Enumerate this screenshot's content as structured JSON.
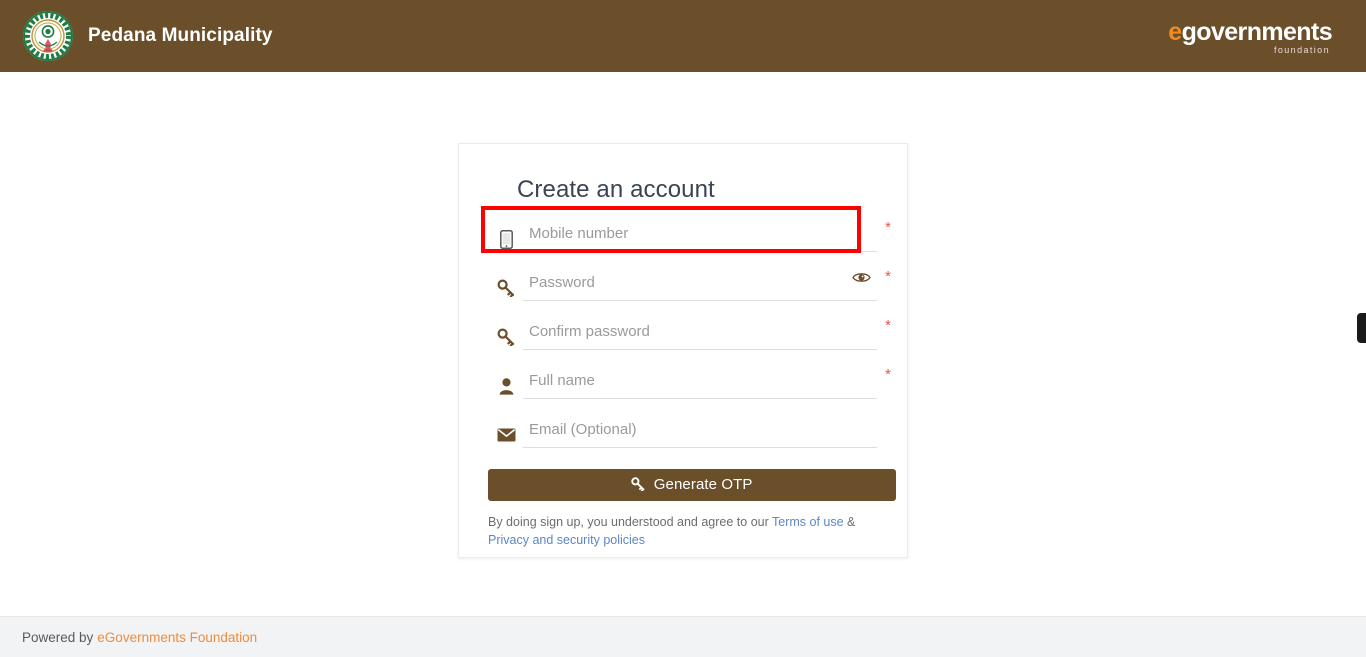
{
  "header": {
    "seal_icon": "ap-government-emblem-icon",
    "title": "Pedana Municipality",
    "logo": {
      "e": "e",
      "word": "governments",
      "sub": "foundation"
    }
  },
  "card": {
    "title": "Create an account",
    "fields": [
      {
        "key": "mobile",
        "icon": "mobile-phone-icon",
        "placeholder": "Mobile number",
        "value": "",
        "required": true,
        "required_marker": "*",
        "has_eye_toggle": false,
        "highlighted": true
      },
      {
        "key": "password",
        "icon": "key-icon",
        "placeholder": "Password",
        "value": "",
        "required": true,
        "required_marker": "*",
        "has_eye_toggle": true,
        "eye_icon": "eye-icon",
        "highlighted": false
      },
      {
        "key": "confirm_password",
        "icon": "key-icon",
        "placeholder": "Confirm password",
        "value": "",
        "required": true,
        "required_marker": "*",
        "has_eye_toggle": false,
        "highlighted": false
      },
      {
        "key": "full_name",
        "icon": "user-icon",
        "placeholder": "Full name",
        "value": "",
        "required": true,
        "required_marker": "*",
        "has_eye_toggle": false,
        "highlighted": false
      },
      {
        "key": "email",
        "icon": "envelope-icon",
        "placeholder": "Email (Optional)",
        "value": "",
        "required": false,
        "required_marker": "",
        "has_eye_toggle": false,
        "highlighted": false
      }
    ],
    "submit": {
      "icon": "key-icon",
      "label": "Generate OTP"
    },
    "terms": {
      "text_before": "By doing sign up, you understood and agree to our ",
      "link1": "Terms of use",
      "separator": " & ",
      "link2": "Privacy and security policies"
    }
  },
  "footer": {
    "text": "Powered by",
    "link": "eGovernments Foundation"
  },
  "colors": {
    "header_brown": "#6b4f2b",
    "accent_orange": "#f18a21",
    "link_blue": "#5b87c7",
    "required_red": "#e8564a",
    "highlight_red": "#ff0000",
    "footer_bg": "#f2f3f5",
    "title_text": "#3a4452"
  }
}
